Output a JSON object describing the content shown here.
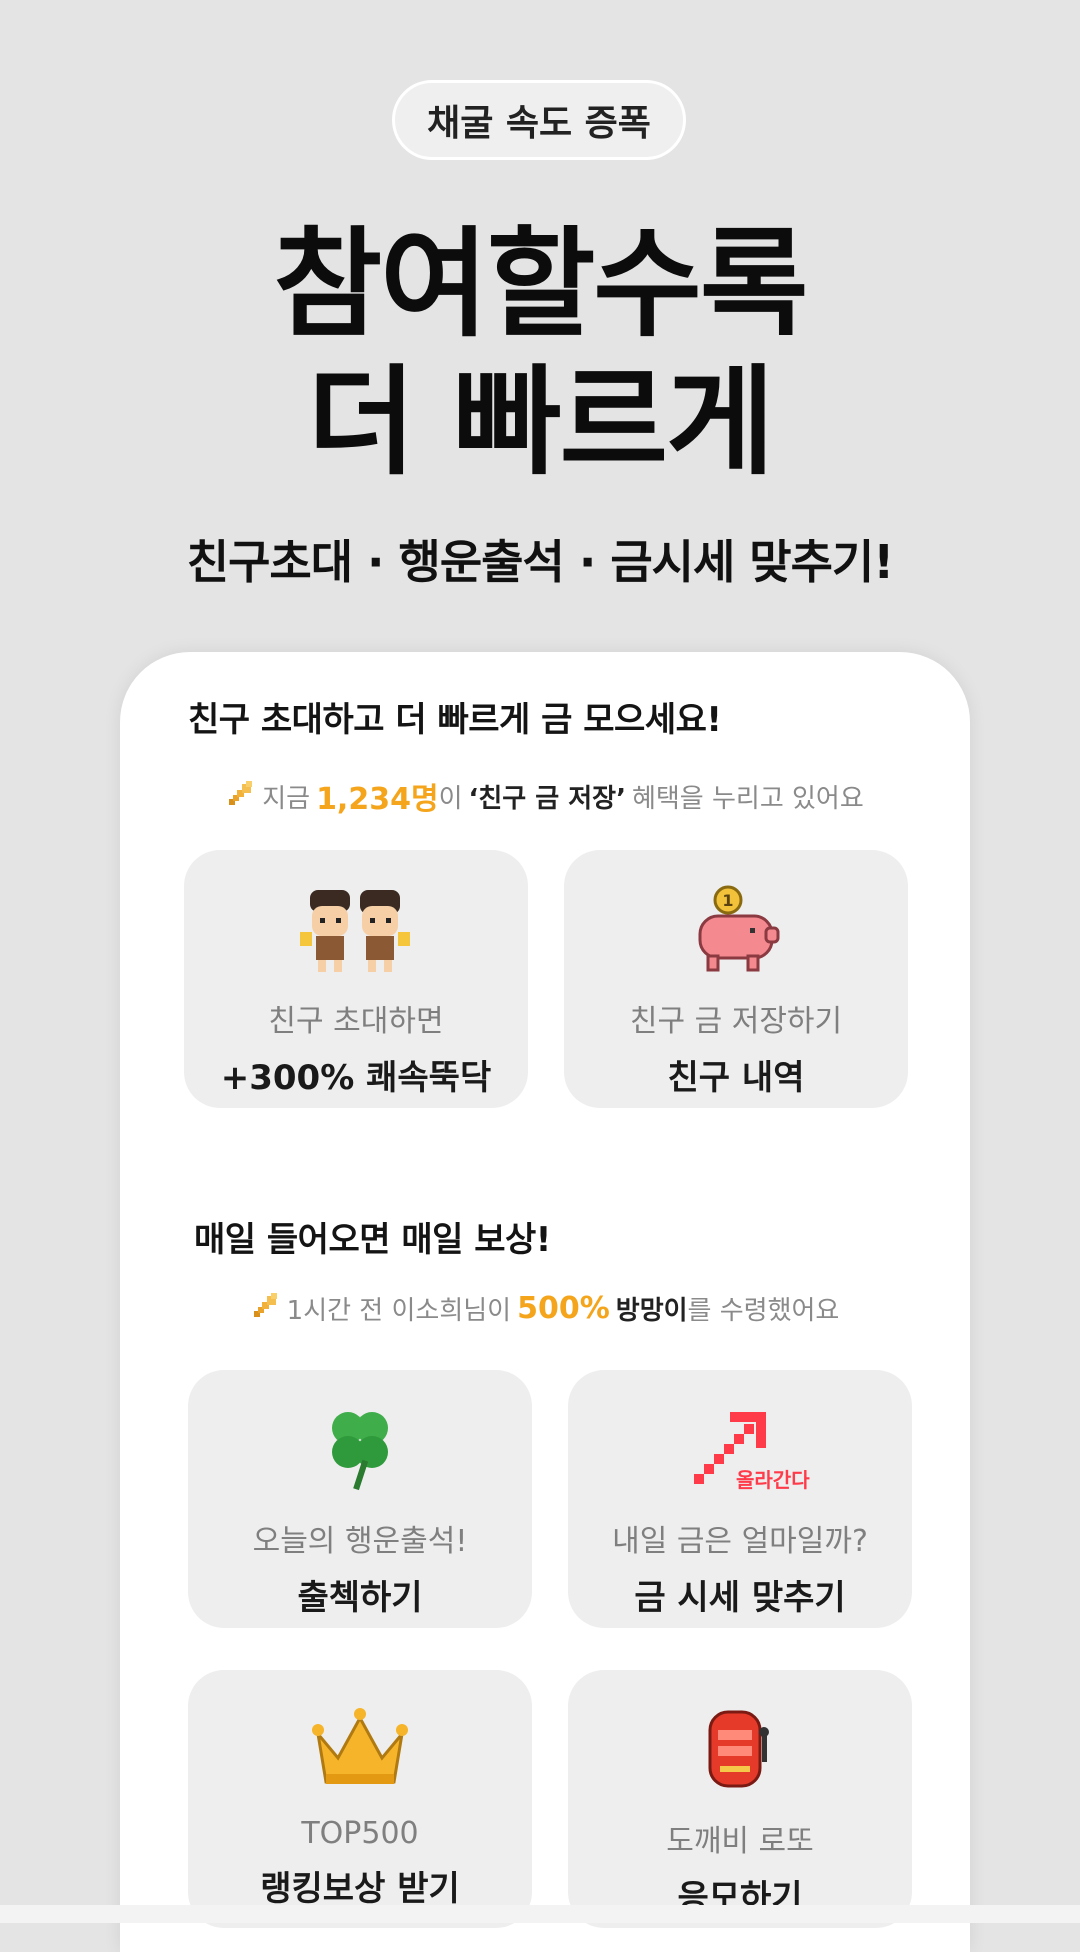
{
  "badge": "채굴 속도 증폭",
  "headline": {
    "line1": "참여할수록",
    "line2": "더 빠르게"
  },
  "subline": "친구초대 · 행운출석 · 금시세 맞추기!",
  "friends_section": {
    "title": "친구 초대하고 더 빠르게 금 모으세요!",
    "notice": {
      "prefix": "지금",
      "count": "1,234명",
      "mid": "이",
      "benefit": "‘친구 금 저장’",
      "suffix": "혜택을 누리고 있어요"
    },
    "tiles": [
      {
        "sub": "친구 초대하면",
        "main": "+300% 쾌속뚝닥",
        "icon": "cavemen-icon"
      },
      {
        "sub": "친구 금 저장하기",
        "main": "친구 내역",
        "icon": "piggy-bank-icon"
      }
    ]
  },
  "daily_section": {
    "title": "매일 들어오면 매일 보상!",
    "notice": {
      "prefix": "1시간 전 이소희님이",
      "percent": "500%",
      "item": "방망이",
      "suffix": "를 수령했어요"
    },
    "tiles": [
      {
        "sub": "오늘의 행운출석!",
        "main": "출첵하기",
        "icon": "clover-icon"
      },
      {
        "sub": "내일 금은 얼마일까?",
        "main": "금 시세 맞추기",
        "icon": "arrow-up-icon",
        "icon_label": "올라간다"
      },
      {
        "sub": "TOP500",
        "main": "랭킹보상 받기",
        "icon": "crown-icon"
      },
      {
        "sub": "도깨비 로또",
        "main": "응모하기",
        "icon": "slot-machine-icon"
      }
    ]
  },
  "colors": {
    "accent_gold": "#f4a51c",
    "arrow_red": "#ff3b4a",
    "background": "#e4e4e4"
  }
}
